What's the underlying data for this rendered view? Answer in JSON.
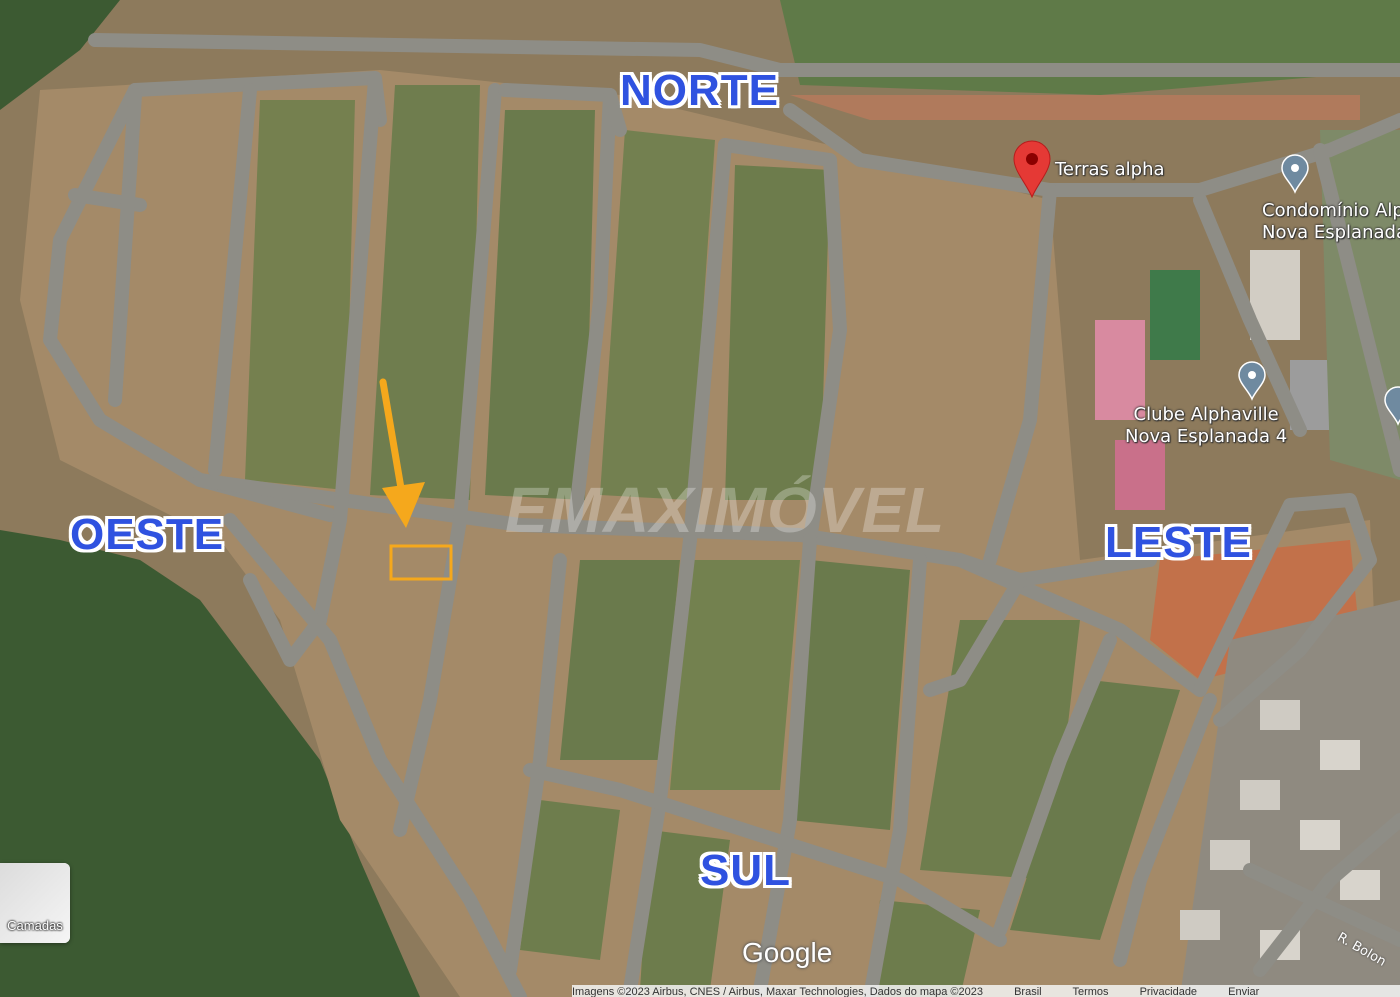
{
  "compass": {
    "north": "NORTE",
    "south": "SUL",
    "west": "OESTE",
    "east": "LESTE"
  },
  "pois": [
    {
      "label": "Terras alpha",
      "icon": "red-pin-icon"
    },
    {
      "label_lines": [
        "Condomínio Alp",
        "Nova Esplanada"
      ],
      "icon": "grey-pin-icon"
    },
    {
      "label_lines": [
        "Clube Alphaville",
        "Nova Esplanada 4"
      ],
      "icon": "grey-pin-icon"
    }
  ],
  "road_label": "R. Bolon",
  "watermark": "EMAXIMÓVEL",
  "branding": "Google",
  "layers_button": {
    "label": "Camadas"
  },
  "attribution": {
    "imagery": "Imagens ©2023 Airbus, CNES / Airbus, Maxar Technologies, Dados do mapa ©2023",
    "links": [
      "Brasil",
      "Termos",
      "Privacidade",
      "Enviar"
    ]
  },
  "colors": {
    "compass_text": "#2f52e0",
    "marker_red": "#e53935",
    "highlight_box": "#f5a81c",
    "arrow": "#f5a81c"
  }
}
